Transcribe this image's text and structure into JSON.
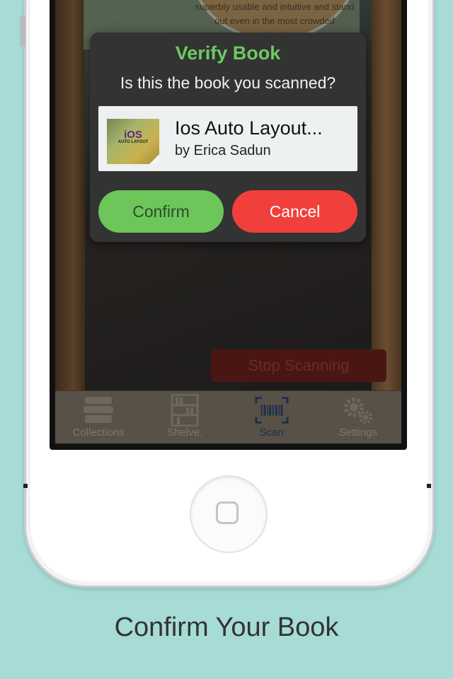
{
  "dialog": {
    "title": "Verify Book",
    "subtitle": "Is this the book you scanned?",
    "book": {
      "title": "Ios Auto Layout...",
      "author": "by Erica Sadun",
      "cover_text": "iOS",
      "cover_subtitle": "AUTO LAYOUT"
    },
    "confirm_label": "Confirm",
    "cancel_label": "Cancel"
  },
  "camera": {
    "poster_text": "superbly usable and intuitive and stand out even in the most crowded marketplace.",
    "stop_label": "Stop Scanning"
  },
  "tabbar": {
    "items": [
      {
        "label": "Collections",
        "icon": "books-stack-icon"
      },
      {
        "label": "Shelve.",
        "icon": "bookshelf-icon"
      },
      {
        "label": "Scan",
        "icon": "barcode-scan-icon",
        "active": true
      },
      {
        "label": "Settings",
        "icon": "gears-icon"
      }
    ]
  },
  "caption": "Confirm Your Book",
  "colors": {
    "background": "#a6dbd6",
    "title_green": "#6ccb5f",
    "confirm_green": "#6cc65a",
    "cancel_red": "#f1403c",
    "active_tab": "#1d2f4c"
  }
}
